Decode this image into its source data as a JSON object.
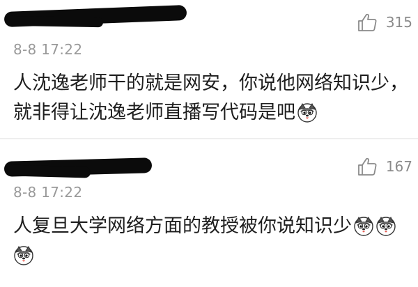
{
  "comments": [
    {
      "time": "8-8 17:22",
      "likes": "315",
      "line1": "人沈逸老师干的就是网安，你说他网络知识少，",
      "line2": "就非得让沈逸老师直播写代码是吧",
      "emojis": [
        "husky-emoji"
      ]
    },
    {
      "time": "8-8 17:22",
      "likes": "167",
      "line1": "人复旦大学网络方面的教授被你说知识少",
      "line2": "",
      "emojis": [
        "husky-emoji",
        "husky-emoji",
        "husky-emoji"
      ]
    }
  ],
  "icons": {
    "like": "thumbs-up-icon",
    "emoji": "husky-emoji"
  },
  "colors": {
    "meta": "#999999",
    "text": "#1e1e1e",
    "redaction": "#0b0b0b"
  }
}
